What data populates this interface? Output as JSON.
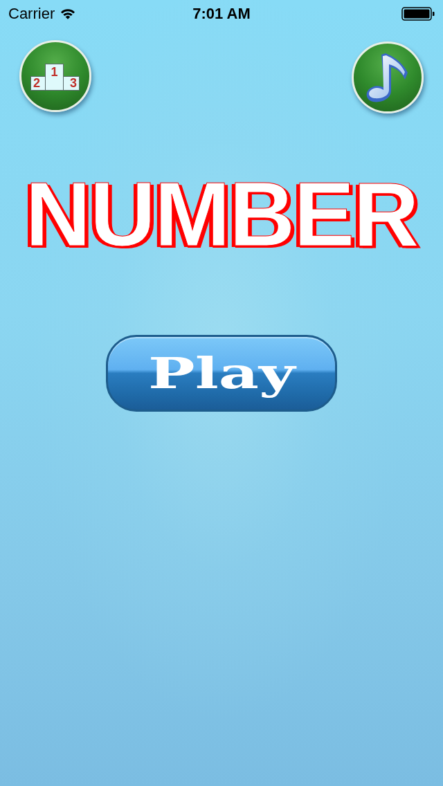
{
  "status_bar": {
    "carrier": "Carrier",
    "time": "7:01 AM"
  },
  "leaderboard_button": {
    "podium_labels": [
      "2",
      "1",
      "3"
    ]
  },
  "title": "NUMBER",
  "play_button": {
    "label": "Play"
  }
}
